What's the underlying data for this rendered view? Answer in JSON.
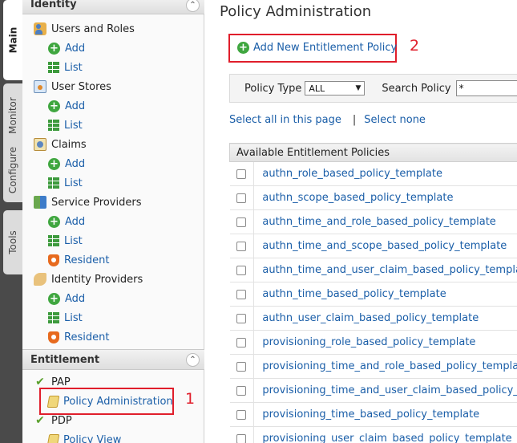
{
  "vertical_tabs": [
    "Main",
    "Monitor",
    "Configure",
    "Tools"
  ],
  "sidebar": {
    "identity": {
      "title": "Identity",
      "groups": [
        {
          "label": "Users and Roles",
          "icon": "users-icon",
          "links": [
            {
              "label": "Add",
              "icon": "add-icon"
            },
            {
              "label": "List",
              "icon": "list-icon"
            }
          ]
        },
        {
          "label": "User Stores",
          "icon": "user-store-icon",
          "links": [
            {
              "label": "Add",
              "icon": "add-icon"
            },
            {
              "label": "List",
              "icon": "list-icon"
            }
          ]
        },
        {
          "label": "Claims",
          "icon": "claims-icon",
          "links": [
            {
              "label": "Add",
              "icon": "add-icon"
            },
            {
              "label": "List",
              "icon": "list-icon"
            }
          ]
        },
        {
          "label": "Service Providers",
          "icon": "service-providers-icon",
          "links": [
            {
              "label": "Add",
              "icon": "add-icon"
            },
            {
              "label": "List",
              "icon": "list-icon"
            },
            {
              "label": "Resident",
              "icon": "resident-icon"
            }
          ]
        },
        {
          "label": "Identity Providers",
          "icon": "identity-providers-icon",
          "links": [
            {
              "label": "Add",
              "icon": "add-icon"
            },
            {
              "label": "List",
              "icon": "list-icon"
            },
            {
              "label": "Resident",
              "icon": "resident-icon"
            }
          ]
        }
      ]
    },
    "entitlement": {
      "title": "Entitlement",
      "pap_label": "PAP",
      "policy_admin_label": "Policy Administration",
      "pdp_label": "PDP",
      "policy_view_label": "Policy View"
    }
  },
  "annotations": {
    "marker1": "1",
    "marker2": "2",
    "color": "#e01e2b"
  },
  "main": {
    "title": "Policy Administration",
    "add_policy_label": "Add New Entitlement Policy",
    "filter": {
      "policy_type_label": "Policy Type",
      "policy_type_value": "ALL",
      "search_label": "Search Policy",
      "search_value": "*"
    },
    "select_all_label": "Select all in this page",
    "separator": "|",
    "select_none_label": "Select none",
    "table": {
      "header": "Available Entitlement Policies",
      "rows": [
        "authn_role_based_policy_template",
        "authn_scope_based_policy_template",
        "authn_time_and_role_based_policy_template",
        "authn_time_and_scope_based_policy_template",
        "authn_time_and_user_claim_based_policy_template",
        "authn_time_based_policy_template",
        "authn_user_claim_based_policy_template",
        "provisioning_role_based_policy_template",
        "provisioning_time_and_role_based_policy_template",
        "provisioning_time_and_user_claim_based_policy_template",
        "provisioning_time_based_policy_template",
        "provisioning_user_claim_based_policy_template"
      ]
    }
  },
  "colors": {
    "link": "#1a5ea8",
    "add_green": "#3fa63f",
    "resident_orange": "#e76a1e",
    "tab_strip": "#4a4a4a"
  }
}
